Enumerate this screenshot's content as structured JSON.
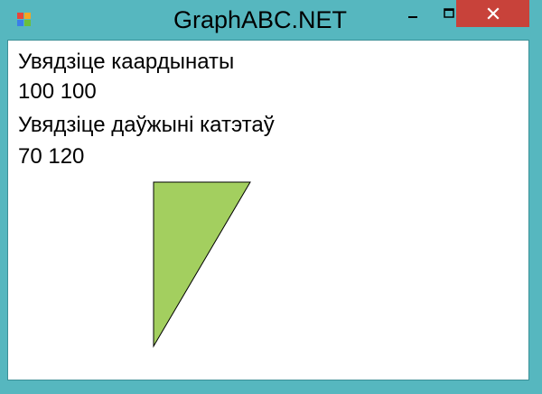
{
  "window": {
    "title": "GraphABC.NET",
    "frame_color": "#56b7bf",
    "close_button_color": "#c8423a"
  },
  "icons": {
    "app": "app-icon",
    "minimize": "minimize-icon",
    "maximize": "maximize-icon",
    "close": "close-icon"
  },
  "console": {
    "prompt_coordinates": "Увядзіце каардынаты",
    "input_coordinates": "100 100",
    "prompt_legs": "Увядзіце даўжыні катэтаў",
    "input_legs": "70 120"
  },
  "drawing": {
    "shape": "right-triangle",
    "fill_color": "#a3cf5f",
    "stroke_color": "#000000"
  }
}
